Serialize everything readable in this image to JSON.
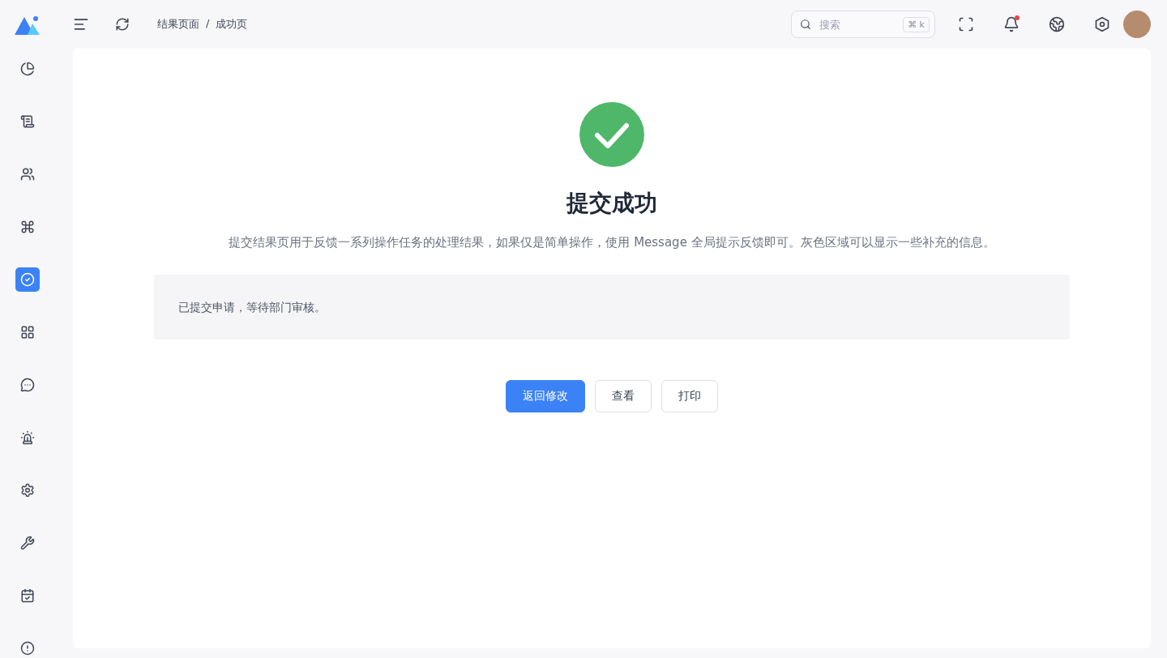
{
  "header": {
    "breadcrumb": [
      "结果页面",
      "/",
      "成功页"
    ],
    "search": {
      "placeholder": "搜索",
      "shortcut": "⌘ k"
    },
    "notification_dot": true
  },
  "sidebar": {
    "items": [
      {
        "selected": false
      },
      {
        "selected": false
      },
      {
        "selected": false
      },
      {
        "selected": false
      },
      {
        "selected": true
      },
      {
        "selected": false
      },
      {
        "selected": false
      },
      {
        "selected": false
      },
      {
        "selected": false
      },
      {
        "selected": false
      },
      {
        "selected": false
      },
      {
        "selected": false
      }
    ]
  },
  "result": {
    "title": "提交成功",
    "description": "提交结果页用于反馈一系列操作任务的处理结果，如果仅是简单操作，使用 Message 全局提示反馈即可。灰色区域可以显示一些补充的信息。",
    "extra": "已提交申请，等待部门审核。",
    "buttons": [
      {
        "label": "返回修改",
        "kind": "primary"
      },
      {
        "label": "查看",
        "kind": "default"
      },
      {
        "label": "打印",
        "kind": "default"
      }
    ]
  }
}
